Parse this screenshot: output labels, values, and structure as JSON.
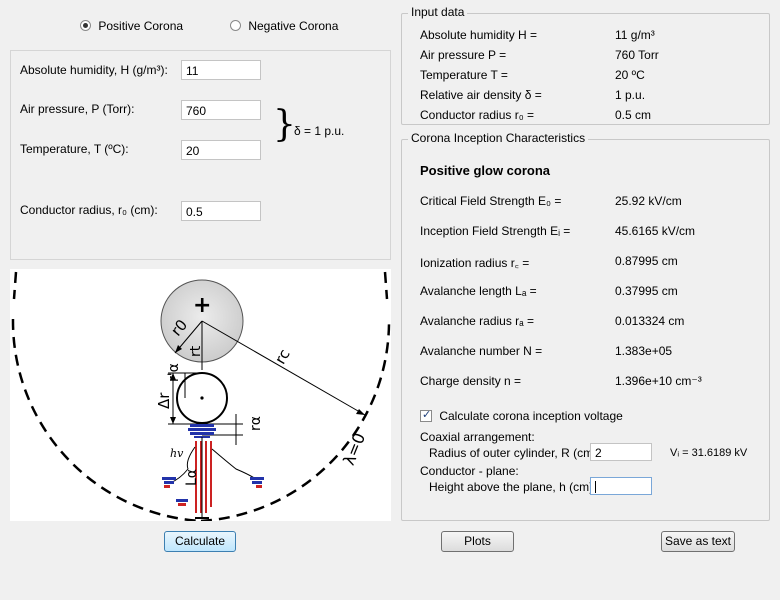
{
  "mode": {
    "positive_label": "Positive Corona",
    "negative_label": "Negative Corona",
    "selected": "positive"
  },
  "inputs": {
    "humidity_label": "Absolute humidity, H (g/m³):",
    "humidity_value": "11",
    "pressure_label": "Air pressure, P (Torr):",
    "pressure_value": "760",
    "temperature_label": "Temperature, T (ºC):",
    "temperature_value": "20",
    "delta_brace": "}",
    "delta_label": "δ = 1 p.u.",
    "radius_label": "Conductor radius, r₀ (cm):",
    "radius_value": "0.5"
  },
  "diagram": {
    "plus": "+",
    "r0": "r0",
    "rt": "rt",
    "rc": "rc",
    "ral": "r'α",
    "dr": "Δr",
    "ra": "rα",
    "hv": "hv",
    "la": "Lα",
    "lambda": "λ=0"
  },
  "input_data": {
    "title": "Input data",
    "rows": [
      {
        "label": "Absolute humidity H =",
        "value": "11 g/m³"
      },
      {
        "label": "Air pressure P =",
        "value": "760 Torr"
      },
      {
        "label": "Temperature T =",
        "value": "20 ºC"
      },
      {
        "label": "Relative air density δ =",
        "value": "1 p.u."
      },
      {
        "label": "Conductor radius r₀ =",
        "value": "0.5 cm"
      }
    ]
  },
  "characteristics": {
    "title": "Corona Inception Characteristics",
    "heading": "Positive glow corona",
    "rows": [
      {
        "label": "Critical Field Strength E₀ =",
        "value": "25.92 kV/cm"
      },
      {
        "label": "Inception Field Strength Eᵢ =",
        "value": "45.6165 kV/cm"
      },
      {
        "label": "Ionization radius r꜀ =",
        "value": "0.87995 cm"
      },
      {
        "label": "Avalanche length Lₐ =",
        "value": "0.37995 cm"
      },
      {
        "label": "Avalanche radius rₐ =",
        "value": "0.013324 cm"
      },
      {
        "label": "Avalanche number N =",
        "value": "1.383e+05"
      },
      {
        "label": "Charge density n =",
        "value": "1.396e+10 cm⁻³"
      }
    ],
    "calc_checkbox_label": "Calculate corona inception voltage",
    "calc_checked": true,
    "coaxial_label": "Coaxial arrangement:",
    "outer_radius_label": "Radius of outer cylinder, R (cm):",
    "outer_radius_value": "2",
    "vi_result": "Vᵢ = 31.6189 kV",
    "plane_label": "Conductor - plane:",
    "height_label": "Height above the plane, h (cm):",
    "height_value": ""
  },
  "buttons": {
    "calculate": "Calculate",
    "plots": "Plots",
    "save": "Save as text"
  }
}
